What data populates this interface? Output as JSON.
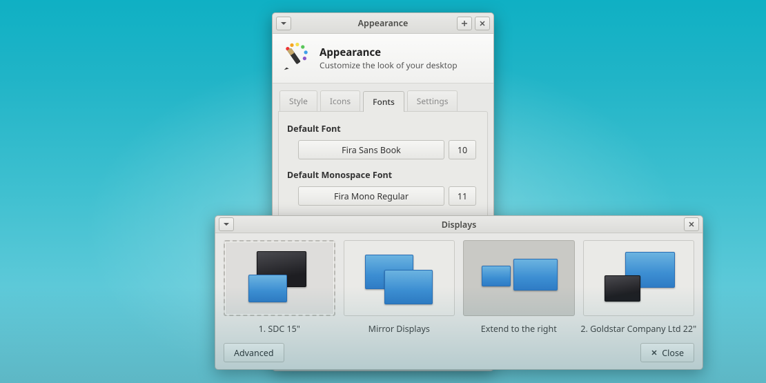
{
  "appearance": {
    "window_title": "Appearance",
    "header_title": "Appearance",
    "header_subtitle": "Customize the look of your desktop",
    "tabs": [
      "Style",
      "Icons",
      "Fonts",
      "Settings"
    ],
    "active_tab": "Fonts",
    "fonts_panel": {
      "default_font_label": "Default Font",
      "default_font_name": "Fira Sans Book",
      "default_font_size": "10",
      "mono_font_label": "Default Monospace Font",
      "mono_font_name": "Fira Mono Regular",
      "mono_font_size": "11"
    }
  },
  "displays": {
    "window_title": "Displays",
    "items": [
      {
        "label": "1. SDC 15\""
      },
      {
        "label": "Mirror Displays"
      },
      {
        "label": "Extend to the right"
      },
      {
        "label": "2. Goldstar Company Ltd 22\""
      }
    ],
    "advanced_button": "Advanced",
    "close_button": "Close"
  }
}
